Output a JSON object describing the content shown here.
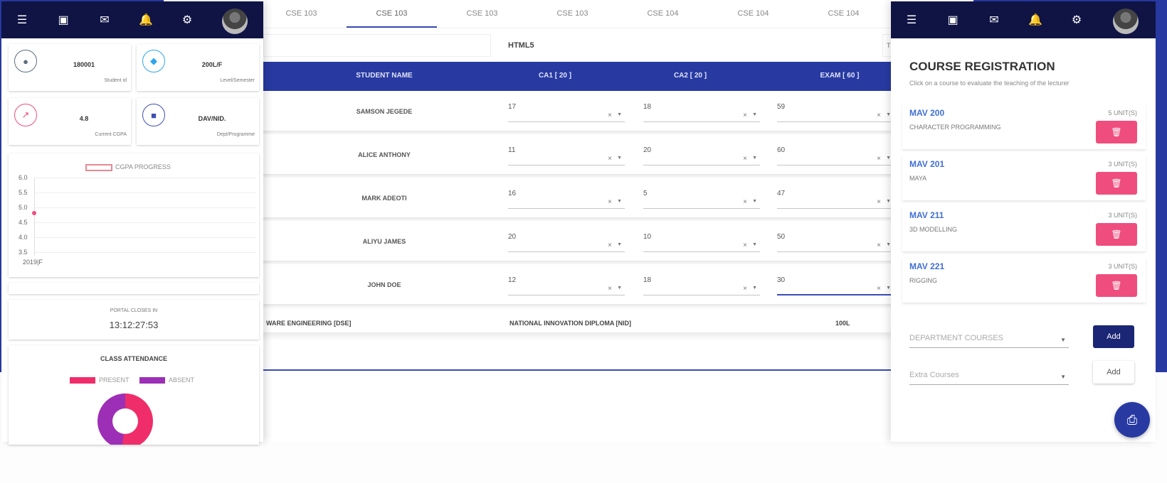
{
  "center": {
    "tabs": [
      "CSE 103",
      "CSE 103",
      "CSE 103",
      "CSE 103",
      "CSE 104",
      "CSE 104",
      "CSE 104"
    ],
    "filter_label": "HTML5",
    "table": {
      "headers": [
        "STUDENT NAME",
        "CA1 [ 20 ]",
        "CA2 [ 20 ]",
        "EXAM [ 60 ]"
      ],
      "rows": [
        {
          "name": "SAMSON JEGEDE",
          "ca1": "17",
          "ca2": "18",
          "exam": "59"
        },
        {
          "name": "ALICE ANTHONY",
          "ca1": "11",
          "ca2": "20",
          "exam": "60"
        },
        {
          "name": "MARK ADEOTI",
          "ca1": "16",
          "ca2": "5",
          "exam": "47"
        },
        {
          "name": "ALIYU JAMES",
          "ca1": "20",
          "ca2": "10",
          "exam": "50"
        },
        {
          "name": "JOHN DOE",
          "ca1": "12",
          "ca2": "18",
          "exam": "30"
        }
      ]
    },
    "footer": {
      "department": "WARE ENGINEERING [DSE]",
      "programme": "NATIONAL INNOVATION DIPLOMA [NID]",
      "level": "100L"
    }
  },
  "left": {
    "stats": [
      {
        "value": "180001",
        "label": "Student id",
        "icon": "user-icon",
        "color": "#5c6e7c"
      },
      {
        "value": "200L/F",
        "label": "Level/Semester",
        "icon": "graduation-cap-icon",
        "color": "#2ea6ee"
      },
      {
        "value": "4.8",
        "label": "Current CGPA",
        "icon": "trend-chart-icon",
        "color": "#ef4d7d"
      },
      {
        "value": "DAV/NID.",
        "label": "Dept/Programme",
        "icon": "book-icon",
        "color": "#3f4fb0"
      }
    ],
    "cgpa_chart": {
      "legend": "CGPA PROGRESS",
      "yticks": [
        "6.0",
        "5.5",
        "5.0",
        "4.5",
        "4.0",
        "3.5"
      ],
      "xticks": [
        "2019|F"
      ]
    },
    "timer": {
      "label": "PORTAL CLOSES IN",
      "value": "13:12:27:53"
    },
    "attendance": {
      "title": "CLASS ATTENDANCE",
      "present_label": "PRESENT",
      "absent_label": "ABSENT",
      "present_color": "#ef2d6a",
      "absent_color": "#9c2fb5"
    }
  },
  "right": {
    "title": "COURSE REGISTRATION",
    "subtitle": "Click on a course to evaluate the teaching of the lecturer",
    "courses": [
      {
        "code": "MAV 200",
        "title": "CHARACTER PROGRAMMING",
        "units": "5 UNIT(S)"
      },
      {
        "code": "MAV 201",
        "title": "MAYA",
        "units": "3 UNIT(S)"
      },
      {
        "code": "MAV 211",
        "title": "3D MODELLING",
        "units": "3 UNIT(S)"
      },
      {
        "code": "MAV 221",
        "title": "RIGGING",
        "units": "3 UNIT(S)"
      }
    ],
    "department_courses_placeholder": "DEPARTMENT COURSES",
    "extra_courses_placeholder": "Extra Courses",
    "add_label": "Add"
  },
  "colors": {
    "primary": "#283aa2",
    "navy": "#0f1444",
    "accent": "#ef4d7d",
    "link": "#3f6fd6"
  },
  "chart_data": {
    "type": "line",
    "title": "",
    "legend": [
      "CGPA PROGRESS"
    ],
    "x": [
      "2019|F"
    ],
    "series": [
      {
        "name": "CGPA PROGRESS",
        "values": [
          4.8
        ]
      }
    ],
    "ylim": [
      3.5,
      6.0
    ],
    "yticks": [
      3.5,
      4.0,
      4.5,
      5.0,
      5.5,
      6.0
    ],
    "grid": true
  }
}
